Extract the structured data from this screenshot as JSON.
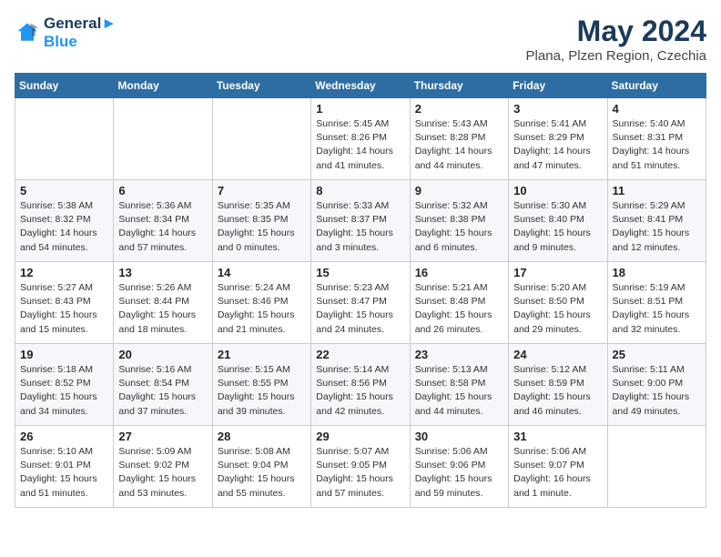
{
  "header": {
    "logo_line1": "General",
    "logo_line2": "Blue",
    "month_title": "May 2024",
    "location": "Plana, Plzen Region, Czechia"
  },
  "weekdays": [
    "Sunday",
    "Monday",
    "Tuesday",
    "Wednesday",
    "Thursday",
    "Friday",
    "Saturday"
  ],
  "weeks": [
    [
      {
        "day": "",
        "content": ""
      },
      {
        "day": "",
        "content": ""
      },
      {
        "day": "",
        "content": ""
      },
      {
        "day": "1",
        "content": "Sunrise: 5:45 AM\nSunset: 8:26 PM\nDaylight: 14 hours\nand 41 minutes."
      },
      {
        "day": "2",
        "content": "Sunrise: 5:43 AM\nSunset: 8:28 PM\nDaylight: 14 hours\nand 44 minutes."
      },
      {
        "day": "3",
        "content": "Sunrise: 5:41 AM\nSunset: 8:29 PM\nDaylight: 14 hours\nand 47 minutes."
      },
      {
        "day": "4",
        "content": "Sunrise: 5:40 AM\nSunset: 8:31 PM\nDaylight: 14 hours\nand 51 minutes."
      }
    ],
    [
      {
        "day": "5",
        "content": "Sunrise: 5:38 AM\nSunset: 8:32 PM\nDaylight: 14 hours\nand 54 minutes."
      },
      {
        "day": "6",
        "content": "Sunrise: 5:36 AM\nSunset: 8:34 PM\nDaylight: 14 hours\nand 57 minutes."
      },
      {
        "day": "7",
        "content": "Sunrise: 5:35 AM\nSunset: 8:35 PM\nDaylight: 15 hours\nand 0 minutes."
      },
      {
        "day": "8",
        "content": "Sunrise: 5:33 AM\nSunset: 8:37 PM\nDaylight: 15 hours\nand 3 minutes."
      },
      {
        "day": "9",
        "content": "Sunrise: 5:32 AM\nSunset: 8:38 PM\nDaylight: 15 hours\nand 6 minutes."
      },
      {
        "day": "10",
        "content": "Sunrise: 5:30 AM\nSunset: 8:40 PM\nDaylight: 15 hours\nand 9 minutes."
      },
      {
        "day": "11",
        "content": "Sunrise: 5:29 AM\nSunset: 8:41 PM\nDaylight: 15 hours\nand 12 minutes."
      }
    ],
    [
      {
        "day": "12",
        "content": "Sunrise: 5:27 AM\nSunset: 8:43 PM\nDaylight: 15 hours\nand 15 minutes."
      },
      {
        "day": "13",
        "content": "Sunrise: 5:26 AM\nSunset: 8:44 PM\nDaylight: 15 hours\nand 18 minutes."
      },
      {
        "day": "14",
        "content": "Sunrise: 5:24 AM\nSunset: 8:46 PM\nDaylight: 15 hours\nand 21 minutes."
      },
      {
        "day": "15",
        "content": "Sunrise: 5:23 AM\nSunset: 8:47 PM\nDaylight: 15 hours\nand 24 minutes."
      },
      {
        "day": "16",
        "content": "Sunrise: 5:21 AM\nSunset: 8:48 PM\nDaylight: 15 hours\nand 26 minutes."
      },
      {
        "day": "17",
        "content": "Sunrise: 5:20 AM\nSunset: 8:50 PM\nDaylight: 15 hours\nand 29 minutes."
      },
      {
        "day": "18",
        "content": "Sunrise: 5:19 AM\nSunset: 8:51 PM\nDaylight: 15 hours\nand 32 minutes."
      }
    ],
    [
      {
        "day": "19",
        "content": "Sunrise: 5:18 AM\nSunset: 8:52 PM\nDaylight: 15 hours\nand 34 minutes."
      },
      {
        "day": "20",
        "content": "Sunrise: 5:16 AM\nSunset: 8:54 PM\nDaylight: 15 hours\nand 37 minutes."
      },
      {
        "day": "21",
        "content": "Sunrise: 5:15 AM\nSunset: 8:55 PM\nDaylight: 15 hours\nand 39 minutes."
      },
      {
        "day": "22",
        "content": "Sunrise: 5:14 AM\nSunset: 8:56 PM\nDaylight: 15 hours\nand 42 minutes."
      },
      {
        "day": "23",
        "content": "Sunrise: 5:13 AM\nSunset: 8:58 PM\nDaylight: 15 hours\nand 44 minutes."
      },
      {
        "day": "24",
        "content": "Sunrise: 5:12 AM\nSunset: 8:59 PM\nDaylight: 15 hours\nand 46 minutes."
      },
      {
        "day": "25",
        "content": "Sunrise: 5:11 AM\nSunset: 9:00 PM\nDaylight: 15 hours\nand 49 minutes."
      }
    ],
    [
      {
        "day": "26",
        "content": "Sunrise: 5:10 AM\nSunset: 9:01 PM\nDaylight: 15 hours\nand 51 minutes."
      },
      {
        "day": "27",
        "content": "Sunrise: 5:09 AM\nSunset: 9:02 PM\nDaylight: 15 hours\nand 53 minutes."
      },
      {
        "day": "28",
        "content": "Sunrise: 5:08 AM\nSunset: 9:04 PM\nDaylight: 15 hours\nand 55 minutes."
      },
      {
        "day": "29",
        "content": "Sunrise: 5:07 AM\nSunset: 9:05 PM\nDaylight: 15 hours\nand 57 minutes."
      },
      {
        "day": "30",
        "content": "Sunrise: 5:06 AM\nSunset: 9:06 PM\nDaylight: 15 hours\nand 59 minutes."
      },
      {
        "day": "31",
        "content": "Sunrise: 5:06 AM\nSunset: 9:07 PM\nDaylight: 16 hours\nand 1 minute."
      },
      {
        "day": "",
        "content": ""
      }
    ]
  ]
}
